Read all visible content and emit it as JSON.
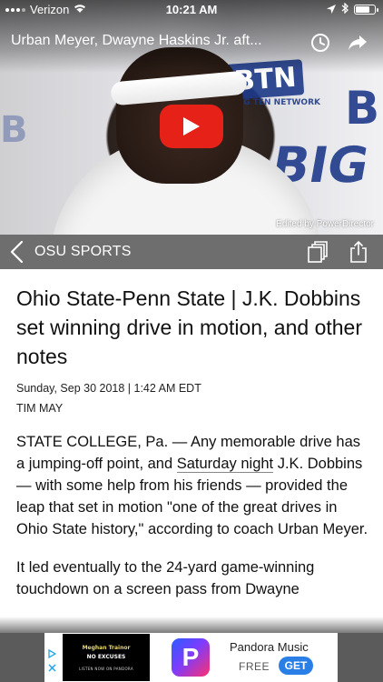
{
  "status_bar": {
    "carrier": "Verizon",
    "time": "10:21 AM",
    "battery_level": 0.8
  },
  "video": {
    "title": "Urban Meyer, Dwayne Haskins Jr. aft...",
    "watermark": "Edited by PowerDirector",
    "play_icon": "youtube-play-icon",
    "backdrop_text": [
      "BTN",
      "BIG TEN NETWORK",
      "B",
      "BIG",
      "B"
    ]
  },
  "nav": {
    "back_icon": "chevron-left-icon",
    "section": "OSU SPORTS",
    "gallery_icon": "stacked-cards-icon",
    "share_icon": "share-icon"
  },
  "article": {
    "headline": "Ohio State-Penn State | J.K. Dobbins set winning drive in motion, and other notes",
    "dateline": "Sunday, Sep 30 2018 | 1:42 AM EDT",
    "byline": "TIM MAY",
    "p1_before": "STATE COLLEGE, Pa. — Any memorable drive has a jumping-off point, and ",
    "p1_link": "Saturday night",
    "p1_after": " J.K. Dobbins — with some help from his friends — provided the leap that set in motion \"one of the great drives in Ohio State history,\" according to coach Urban Meyer.",
    "p2": "It led eventually to the 24-yard game-winning touchdown on a screen pass from Dwayne"
  },
  "ad": {
    "banner_line1": "Meghan Trainor",
    "banner_line2": "NO EXCUSES",
    "banner_line3": "LISTEN NOW ON PANDORA",
    "logo_letter": "P",
    "app_name": "Pandora Music",
    "price": "FREE",
    "get_label": "GET",
    "choices_icon": "ad-choices-icon",
    "close_icon": "close-icon"
  }
}
